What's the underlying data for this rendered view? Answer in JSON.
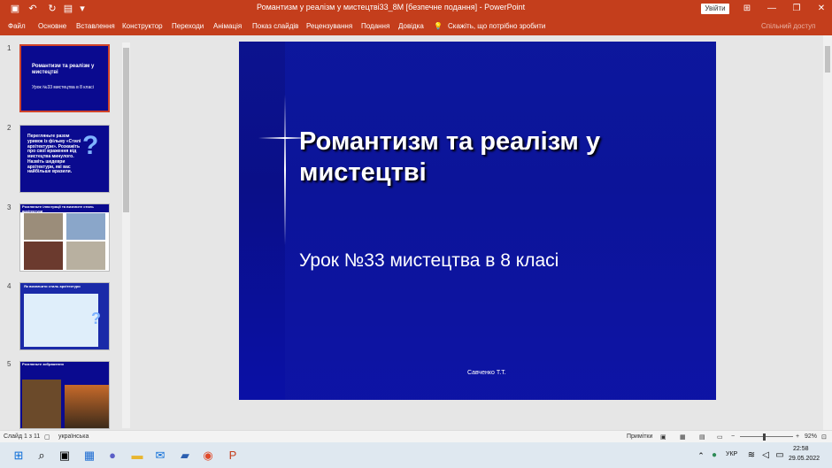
{
  "titlebar": {
    "title": "Романтизм у реалізм у мистецтві33_8М [безпечне подання] - PowerPoint",
    "login_label": "Увійти",
    "save_icon": "save-icon",
    "undo_icon": "undo-icon",
    "redo_icon": "redo-icon"
  },
  "menu": {
    "items": [
      "Файл",
      "Основне",
      "Вставлення",
      "Конструктор",
      "Переходи",
      "Анімація",
      "Показ слайдів",
      "Рецензування",
      "Подання",
      "Довідка"
    ],
    "tell_me": "Скажіть, що потрібно зробити",
    "share": "Спільний доступ"
  },
  "thumbnails": [
    {
      "num": "1",
      "text": "Романтизм та реалізм у мистецтві",
      "sub": "Урок №33 мистецтва в 8 класі"
    },
    {
      "num": "2",
      "text": "Перегляньте разом уривок із фільму «Стилі архітектури». Розкажіть про свої враження від мистецтва минулого. Назвіть шедеври архітектури, які вас найбільше вразили."
    },
    {
      "num": "3",
      "text": "Розгляньте ілюстрації та визначте стиль архітектури"
    },
    {
      "num": "4",
      "text": "Як визначити стиль архітектури"
    },
    {
      "num": "5",
      "text": "Розгляньте зображення"
    }
  ],
  "slide": {
    "title": "Романтизм та реалізм у мистецтві",
    "subtitle": "Урок №33 мистецтва в 8 класі",
    "author": "Савченко Т.Т."
  },
  "status": {
    "slide_counter": "Слайд 1 з 11",
    "language": "українська",
    "notes": "Примітки",
    "zoom": "92%"
  },
  "taskbar": {
    "lang": "УКР",
    "time": "22:58",
    "date": "29.05.2022"
  },
  "colors": {
    "accent": "#c43e1c",
    "slide_bg": "#0a0f88"
  }
}
